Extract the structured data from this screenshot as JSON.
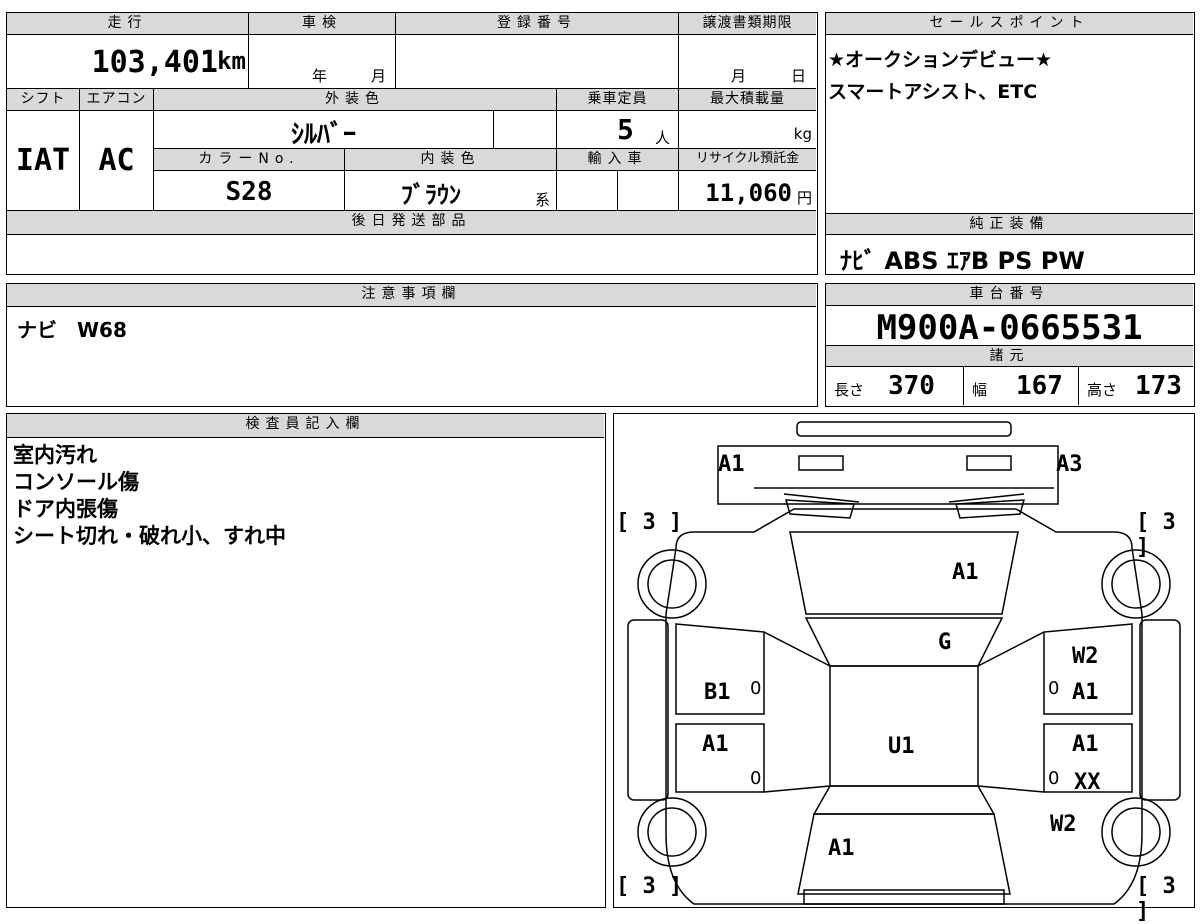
{
  "sheet": {
    "mileage": {
      "label": "走行",
      "value": "103,401",
      "unit": "km"
    },
    "inspection": {
      "label": "車検",
      "year_unit": "年",
      "month_unit": "月"
    },
    "registration": {
      "label": "登録番号"
    },
    "transfer_deadline": {
      "label": "譲渡書類期限",
      "month_unit": "月",
      "day_unit": "日"
    },
    "shift": {
      "label": "シフト",
      "value": "IAT"
    },
    "aircon": {
      "label": "エアコン",
      "value": "AC"
    },
    "exterior_color": {
      "label": "外装色",
      "value": "ｼﾙﾊﾞｰ"
    },
    "capacity": {
      "label": "乗車定員",
      "value": "5",
      "unit": "人"
    },
    "max_load": {
      "label": "最大積載量",
      "unit": "kg"
    },
    "color_no": {
      "label": "カラーNo.",
      "value": "S28"
    },
    "interior_color": {
      "label": "内装色",
      "value": "ﾌﾞﾗｳﾝ",
      "suffix": "系"
    },
    "import": {
      "label": "輸入車"
    },
    "recycle": {
      "label": "リサイクル預託金",
      "value": "11,060",
      "unit": "円"
    },
    "later_parts": {
      "label": "後日発送部品"
    },
    "notes": {
      "label": "注意事項欄",
      "line1": "ナビ　W68"
    },
    "inspector": {
      "label": "検査員記入欄",
      "lines": [
        "室内汚れ",
        "コンソール傷",
        "ドア内張傷",
        "シート切れ・破れ小、すれ中"
      ]
    },
    "sales_points": {
      "label": "セールスポイント",
      "line1": "★オークションデビュー★",
      "line2": "スマートアシスト、ETC"
    },
    "equipment": {
      "label": "純正装備",
      "value": "ﾅﾋﾞ ABS ｴｱB PS PW"
    },
    "chassis": {
      "label": "車台番号",
      "value": "M900A-0665531"
    },
    "specs": {
      "label": "諸元",
      "length_label": "長さ",
      "length": "370",
      "width_label": "幅",
      "width": "167",
      "height_label": "高さ",
      "height": "173"
    }
  },
  "diagram": {
    "tires": [
      "[ 3 ]",
      "[ 3 ]",
      "[ 3 ]",
      "[ 3 ]"
    ],
    "marks": {
      "front_left": "A1",
      "front_right": "A3",
      "hood": "A1",
      "windshield": "G",
      "left_front_door": "B1",
      "left_rear_door": "A1",
      "roof": "U1",
      "right_fender": "W2",
      "right_front_door": "A1",
      "right_rear_door": "A1",
      "right_rear_xx": "XX",
      "right_rear_quarter": "W2",
      "rear": "A1",
      "zero": "0"
    }
  }
}
